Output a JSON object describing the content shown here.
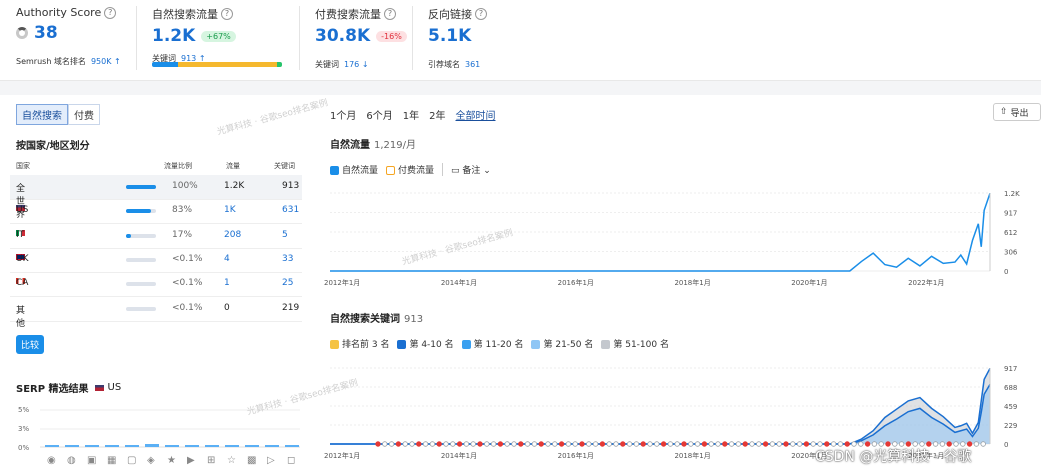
{
  "metrics": {
    "authority": {
      "label": "Authority Score",
      "value": "38",
      "sub_label": "Semrush 域名排名",
      "sub_value": "950K ↑"
    },
    "organic": {
      "label": "自然搜索流量",
      "value": "1.2K",
      "badge": "+67%",
      "sub_label": "关键词",
      "sub_value": "913 ↑"
    },
    "paid": {
      "label": "付费搜索流量",
      "value": "30.8K",
      "badge": "-16%",
      "sub_label": "关键词",
      "sub_value": "176 ↓"
    },
    "backlinks": {
      "label": "反向链接",
      "value": "5.1K",
      "sub_label": "引荐域名",
      "sub_value": "361"
    }
  },
  "stack_colors": [
    "#f5b82e",
    "#1a8ee8",
    "#27c46b"
  ],
  "left": {
    "tabs": [
      "自然搜索",
      "付费"
    ],
    "section_title": "按国家/地区划分",
    "table_headers": [
      "国家",
      "流量比例",
      "流量",
      "关键词"
    ],
    "rows": [
      {
        "country": "全世界",
        "share": "100%",
        "share_val": 100,
        "traffic": "1.2K",
        "keywords": "913",
        "flag": ""
      },
      {
        "country": "US",
        "share": "83%",
        "share_val": 83,
        "traffic": "1K",
        "keywords": "631",
        "flag": "us"
      },
      {
        "country": "IT",
        "share": "17%",
        "share_val": 17,
        "traffic": "208",
        "keywords": "5",
        "flag": "it"
      },
      {
        "country": "UK",
        "share": "<0.1%",
        "share_val": 0,
        "traffic": "4",
        "keywords": "33",
        "flag": "uk"
      },
      {
        "country": "CA",
        "share": "<0.1%",
        "share_val": 0,
        "traffic": "1",
        "keywords": "25",
        "flag": "ca"
      },
      {
        "country": "其他",
        "share": "<0.1%",
        "share_val": 0,
        "traffic": "0",
        "keywords": "219",
        "flag": ""
      }
    ],
    "compare_button": "比较",
    "serp_title": "SERP 精选结果",
    "serp_country": "US",
    "serp_ticks": [
      "5%",
      "3%",
      "0%"
    ]
  },
  "right": {
    "ranges": [
      "1个月",
      "6个月",
      "1年",
      "2年",
      "全部时间"
    ],
    "export_label": "导出",
    "traffic_title": "自然流量",
    "traffic_count": "1,219/月",
    "traffic_legend": [
      "自然流量",
      "付费流量",
      "备注"
    ],
    "kw_title": "自然搜索关键词",
    "kw_count": "913",
    "kw_legend": [
      "排名前 3 名",
      "第 4-10 名",
      "第 11-20 名",
      "第 21-50 名",
      "第 51-100 名"
    ],
    "kw_legend_colors": [
      "#f5c343",
      "#1a6fd1",
      "#3aa0f0",
      "#8fc6f5",
      "#c4c8ce"
    ]
  },
  "chart_data": [
    {
      "type": "line",
      "title": "自然流量",
      "x_ticks": [
        "2012年1月",
        "2014年1月",
        "2016年1月",
        "2018年1月",
        "2020年1月",
        "2022年1月"
      ],
      "y_ticks": [
        "1.2K",
        "917",
        "612",
        "306",
        "0"
      ],
      "ylim": [
        0,
        1223
      ],
      "series": [
        {
          "name": "自然流量",
          "color": "#1a8ee8",
          "x": [
            2012.0,
            2020.9,
            2021.1,
            2021.3,
            2021.5,
            2021.7,
            2021.9,
            2022.1,
            2022.3,
            2022.5,
            2022.7,
            2022.8,
            2022.9,
            2023.0,
            2023.1,
            2023.15,
            2023.2,
            2023.3
          ],
          "y": [
            0,
            0,
            150,
            280,
            100,
            60,
            200,
            80,
            230,
            120,
            140,
            250,
            110,
            480,
            740,
            380,
            950,
            1219
          ]
        }
      ]
    },
    {
      "type": "area",
      "title": "自然搜索关键词",
      "x_ticks": [
        "2012年1月",
        "2014年1月",
        "2016年1月",
        "2018年1月",
        "2020年1月",
        "2022年1月"
      ],
      "y_ticks": [
        "917",
        "688",
        "459",
        "229",
        "0"
      ],
      "ylim": [
        0,
        917
      ],
      "series": [
        {
          "name": "第 51-100 名",
          "color": "#c4c8ce",
          "x": [
            2012.0,
            2020.9,
            2021.1,
            2021.3,
            2021.5,
            2021.7,
            2021.9,
            2022.1,
            2022.3,
            2022.5,
            2022.7,
            2022.8,
            2022.9,
            2023.0,
            2023.1,
            2023.15,
            2023.2,
            2023.3
          ],
          "y": [
            0,
            0,
            60,
            160,
            320,
            420,
            520,
            560,
            430,
            330,
            200,
            220,
            250,
            130,
            260,
            520,
            780,
            913
          ]
        },
        {
          "name": "第 21-50 名",
          "color": "#8fc6f5",
          "x": [
            2012.0,
            2020.9,
            2021.1,
            2021.3,
            2021.5,
            2021.7,
            2021.9,
            2022.1,
            2022.3,
            2022.5,
            2022.7,
            2022.8,
            2022.9,
            2023.0,
            2023.1,
            2023.15,
            2023.2,
            2023.3
          ],
          "y": [
            0,
            0,
            40,
            110,
            220,
            300,
            390,
            430,
            320,
            240,
            140,
            160,
            180,
            90,
            190,
            380,
            600,
            720
          ]
        }
      ]
    }
  ]
}
